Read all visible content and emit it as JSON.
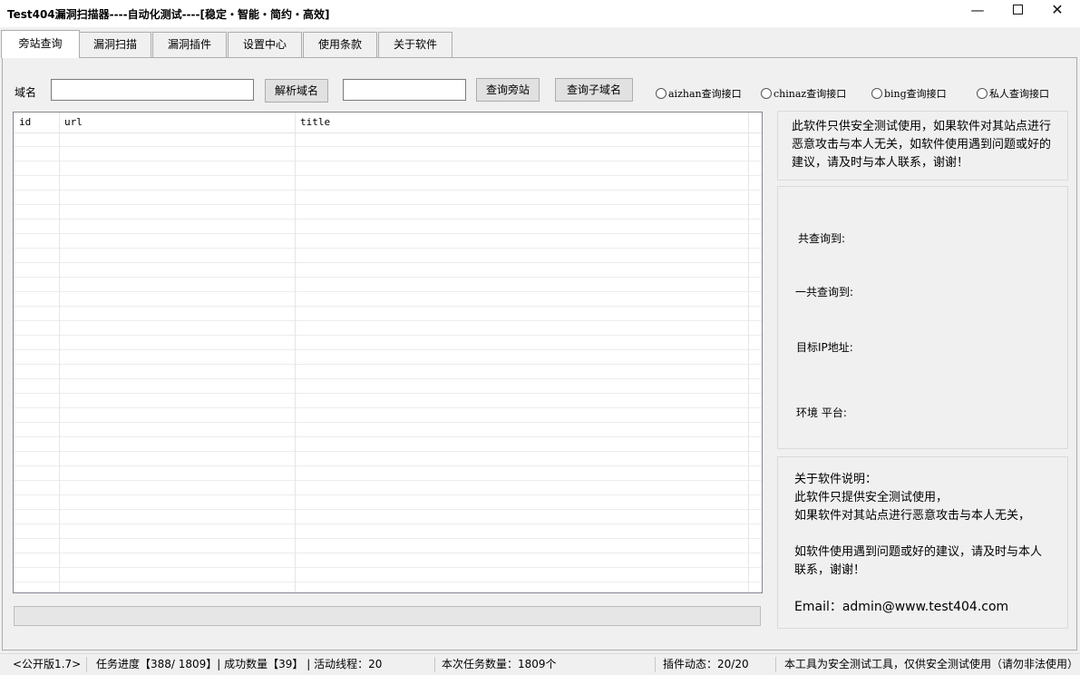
{
  "window": {
    "title": "Test404漏洞扫描器----自动化测试----[稳定・智能・简约・高效]",
    "min_glyph": "—",
    "close_glyph": "✕"
  },
  "tabs": [
    {
      "label": "旁站查询",
      "active": true
    },
    {
      "label": "漏洞扫描",
      "active": false
    },
    {
      "label": "漏洞插件",
      "active": false
    },
    {
      "label": "设置中心",
      "active": false
    },
    {
      "label": "使用条款",
      "active": false
    },
    {
      "label": "关于软件",
      "active": false
    }
  ],
  "toolbar": {
    "domain_label": "域名",
    "domain_value": "",
    "resolve_button": "解析域名",
    "ip_value": "",
    "query_sites_button": "查询旁站",
    "query_subdomain_button": "查询子域名",
    "radios": [
      {
        "label": "aizhan查询接口",
        "checked": false
      },
      {
        "label": "chinaz查询接口",
        "checked": false
      },
      {
        "label": "bing查询接口",
        "checked": false
      },
      {
        "label": "私人查询接口",
        "checked": false
      }
    ]
  },
  "table": {
    "columns": [
      "id",
      "url",
      "title"
    ],
    "rows": []
  },
  "progress": {
    "value_percent": 0
  },
  "side": {
    "disclaimer": "此软件只供安全测试使用，如果软件对其站点进行恶意攻击与本人无关，如软件使用遇到问题或好的建议，请及时与本人联系，谢谢！",
    "total_found_label": "共查询到:",
    "all_found_label": "一共查询到:",
    "target_ip_label": "目标IP地址:",
    "env_label": "环境 平台:",
    "about_title": "关于软件说明：",
    "about_lines": [
      "此软件只提供安全测试使用，",
      "如果软件对其站点进行恶意攻击与本人无关，",
      "如软件使用遇到问题或好的建议，请及时与本人联系，谢谢！"
    ],
    "email": "Email：admin@www.test404.com"
  },
  "status": {
    "version": "<公开版1.7>",
    "task_progress": "任务进度【388/ 1809】| 成功数量【39】 | 活动线程：20",
    "task_count": "本次任务数量：1809个",
    "plugin_status": "插件动态：20/20",
    "notice": "本工具为安全测试工具，仅供安全测试使用（请勿非法使用）"
  }
}
